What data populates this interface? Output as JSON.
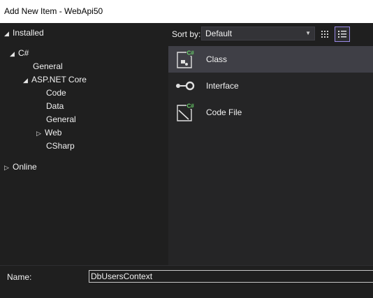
{
  "window": {
    "title": "Add New Item - WebApi50"
  },
  "tree": {
    "installed": "Installed",
    "csharp": "C#",
    "general": "General",
    "aspnetcore": "ASP.NET Core",
    "code": "Code",
    "data": "Data",
    "general2": "General",
    "web": "Web",
    "csharp_node": "CSharp",
    "online": "Online"
  },
  "sort": {
    "label": "Sort by:",
    "value": "Default"
  },
  "templates": [
    {
      "label": "Class",
      "icon": "class-icon",
      "selected": true
    },
    {
      "label": "Interface",
      "icon": "interface-icon",
      "selected": false
    },
    {
      "label": "Code File",
      "icon": "code-file-icon",
      "selected": false
    }
  ],
  "name": {
    "label": "Name:",
    "value": "DbUsersContext"
  },
  "colors": {
    "background": "#1f1f1f",
    "list_background": "#252526",
    "selected_row": "#3f3f46",
    "accent_csharp": "#6ad26a",
    "view_toggle_border": "#9b8be8"
  }
}
